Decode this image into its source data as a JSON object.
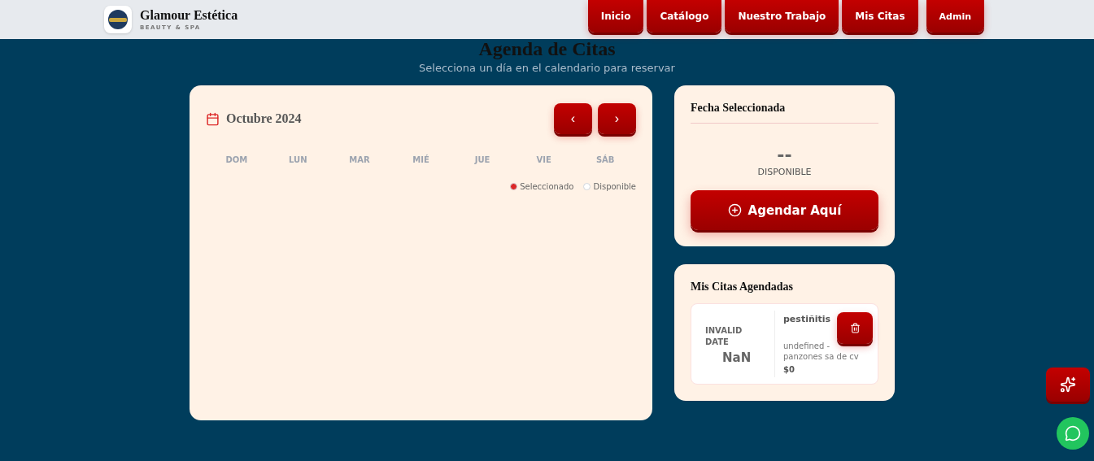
{
  "brand": {
    "name": "Glamour Estética",
    "tagline": "BEAUTY & SPA"
  },
  "nav": [
    {
      "label": "Inicio"
    },
    {
      "label": "Catálogo"
    },
    {
      "label": "Nuestro Trabajo"
    },
    {
      "label": "Mis Citas"
    },
    {
      "label": "Admin"
    }
  ],
  "page": {
    "title": "Agenda de Citas",
    "subtitle": "Selecciona un día en el calendario para reservar"
  },
  "calendar": {
    "month": "Octubre 2024",
    "prev": "‹",
    "next": "›",
    "weekdays": [
      "DOM",
      "LUN",
      "MAR",
      "MIÉ",
      "JUE",
      "VIE",
      "SÁB"
    ],
    "legend": [
      {
        "label": "Seleccionado",
        "color": "#dc2626"
      },
      {
        "label": "Disponible",
        "color": "#ffffff"
      }
    ]
  },
  "selected_date": {
    "title": "Fecha Seleccionada",
    "day": "--",
    "status": "DISPONIBLE",
    "button": "Agendar Aquí"
  },
  "appointments": {
    "title": "Mis Citas Agendadas",
    "items": [
      {
        "month": "INVALID DATE",
        "day": "NaN",
        "service": "pestiñitis",
        "detail": "undefined - panzones sa de cv",
        "price": "$0"
      }
    ]
  }
}
